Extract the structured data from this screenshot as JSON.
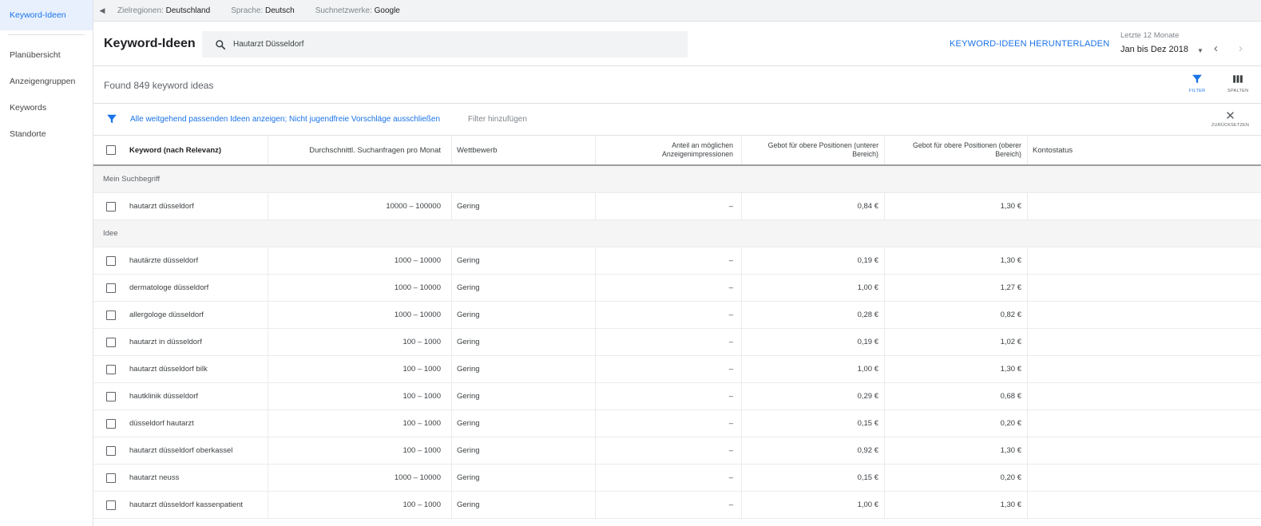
{
  "sidebar": {
    "items": [
      {
        "label": "Keyword-Ideen"
      },
      {
        "label": "Planübersicht"
      },
      {
        "label": "Anzeigengruppen"
      },
      {
        "label": "Keywords"
      },
      {
        "label": "Standorte"
      }
    ]
  },
  "topbar": {
    "region_label": "Zielregionen:",
    "region_value": "Deutschland",
    "language_label": "Sprache:",
    "language_value": "Deutsch",
    "network_label": "Suchnetzwerke:",
    "network_value": "Google"
  },
  "header": {
    "title": "Keyword-Ideen",
    "search_value": "Hautarzt Düsseldorf",
    "download_label": "KEYWORD-IDEEN HERUNTERLADEN",
    "date_range_label": "Letzte 12 Monate",
    "date_range_value": "Jan bis Dez 2018"
  },
  "toolbar": {
    "found_text": "Found 849 keyword ideas",
    "filter_label": "FILTER",
    "columns_label": "SPALTEN"
  },
  "filter_bar": {
    "active_filters": "Alle weitgehend passenden Ideen anzeigen; Nicht jugendfreie Vorschläge ausschließen",
    "add_filter": "Filter hinzufügen",
    "reset_label": "ZURÜCKSETZEN"
  },
  "table": {
    "columns": {
      "keyword": "Keyword (nach Relevanz)",
      "volume": "Durchschnittl. Suchanfragen pro Monat",
      "competition": "Wettbewerb",
      "impression_share": "Anteil an möglichen Anzeigenimpressionen",
      "bid_low": "Gebot für obere Positionen (unterer Bereich)",
      "bid_high": "Gebot für obere Positionen (oberer Bereich)",
      "account_status": "Kontostatus"
    },
    "group_own": "Mein Suchbegriff",
    "own_rows": [
      {
        "keyword": "hautarzt düsseldorf",
        "volume": "10000 – 100000",
        "competition": "Gering",
        "share": "–",
        "low": "0,84 €",
        "high": "1,30 €",
        "status": ""
      }
    ],
    "group_ideas": "Idee",
    "idea_rows": [
      {
        "keyword": "hautärzte düsseldorf",
        "volume": "1000 – 10000",
        "competition": "Gering",
        "share": "–",
        "low": "0,19 €",
        "high": "1,30 €",
        "status": ""
      },
      {
        "keyword": "dermatologe düsseldorf",
        "volume": "1000 – 10000",
        "competition": "Gering",
        "share": "–",
        "low": "1,00 €",
        "high": "1,27 €",
        "status": ""
      },
      {
        "keyword": "allergologe düsseldorf",
        "volume": "1000 – 10000",
        "competition": "Gering",
        "share": "–",
        "low": "0,28 €",
        "high": "0,82 €",
        "status": ""
      },
      {
        "keyword": "hautarzt in düsseldorf",
        "volume": "100 – 1000",
        "competition": "Gering",
        "share": "–",
        "low": "0,19 €",
        "high": "1,02 €",
        "status": ""
      },
      {
        "keyword": "hautarzt düsseldorf bilk",
        "volume": "100 – 1000",
        "competition": "Gering",
        "share": "–",
        "low": "1,00 €",
        "high": "1,30 €",
        "status": ""
      },
      {
        "keyword": "hautklinik düsseldorf",
        "volume": "100 – 1000",
        "competition": "Gering",
        "share": "–",
        "low": "0,29 €",
        "high": "0,68 €",
        "status": ""
      },
      {
        "keyword": "düsseldorf hautarzt",
        "volume": "100 – 1000",
        "competition": "Gering",
        "share": "–",
        "low": "0,15 €",
        "high": "0,20 €",
        "status": ""
      },
      {
        "keyword": "hautarzt düsseldorf oberkassel",
        "volume": "100 – 1000",
        "competition": "Gering",
        "share": "–",
        "low": "0,92 €",
        "high": "1,30 €",
        "status": ""
      },
      {
        "keyword": "hautarzt neuss",
        "volume": "1000 – 10000",
        "competition": "Gering",
        "share": "–",
        "low": "0,15 €",
        "high": "0,20 €",
        "status": ""
      },
      {
        "keyword": "hautarzt düsseldorf kassenpatient",
        "volume": "100 – 1000",
        "competition": "Gering",
        "share": "–",
        "low": "1,00 €",
        "high": "1,30 €",
        "status": ""
      }
    ]
  },
  "colors": {
    "accent": "#1a73e8",
    "sidebar_active_bg": "#e8f0fe",
    "group_bg": "#f5f5f5"
  },
  "icons": [
    "back-arrow-icon",
    "search-icon",
    "filter-icon",
    "columns-icon",
    "close-icon",
    "dropdown-arrow-icon",
    "chevron-left-icon",
    "chevron-right-icon",
    "checkbox-icon"
  ]
}
